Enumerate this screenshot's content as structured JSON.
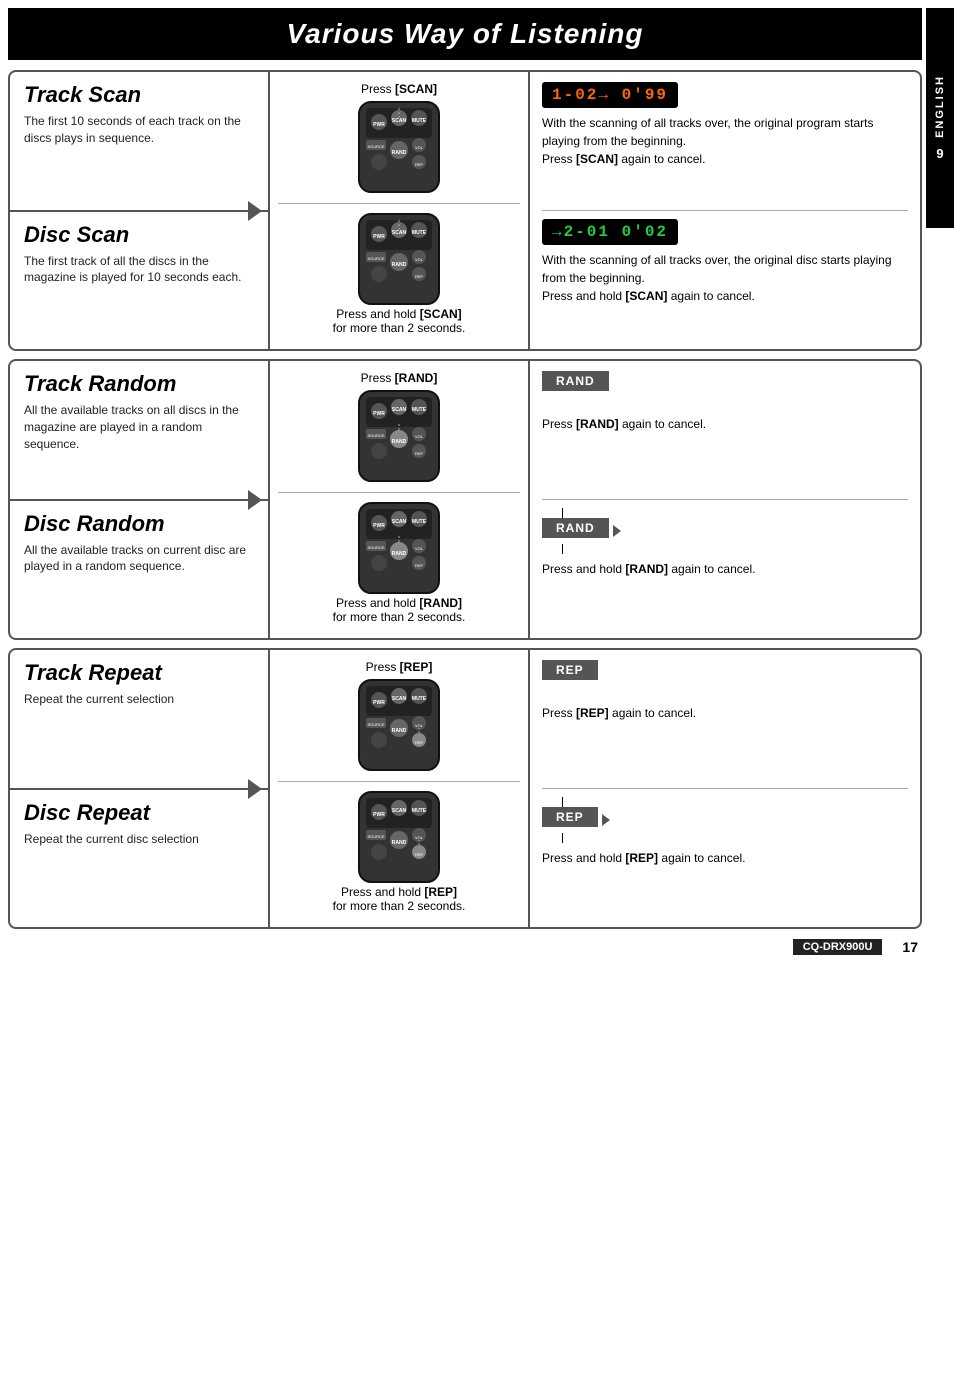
{
  "page": {
    "title": "Various Way of Listening",
    "model": "CQ-DRX900U",
    "page_number": "17",
    "side_tab": {
      "letters": "ENGLISH",
      "number": "9"
    }
  },
  "sections": [
    {
      "id": "scan",
      "features": [
        {
          "id": "track-scan",
          "title": "Track Scan",
          "desc": "The first 10 seconds of each track on the discs plays in sequence."
        },
        {
          "id": "disc-scan",
          "title": "Disc Scan",
          "desc": "The first track of all the discs in the magazine is played for 10 seconds each."
        }
      ],
      "middle": {
        "top_label": "Press [SCAN]",
        "bottom_label": "Press and hold [SCAN] for more than 2 seconds."
      },
      "right": {
        "top": {
          "lcd": "1-02→ 0'99",
          "desc": "With the scanning of all tracks over, the original program starts playing from the beginning.",
          "action": "Press [SCAN] again to cancel."
        },
        "bottom": {
          "lcd": "→2-01  0'02",
          "desc": "With the scanning of all tracks over, the original disc starts playing from the beginning.",
          "action": "Press and hold [SCAN] again to cancel."
        }
      }
    },
    {
      "id": "random",
      "features": [
        {
          "id": "track-random",
          "title": "Track Random",
          "desc": "All the available tracks on all discs in the magazine are played in a random sequence."
        },
        {
          "id": "disc-random",
          "title": "Disc Random",
          "desc": "All the available tracks on current disc are played in a random sequence."
        }
      ],
      "middle": {
        "top_label": "Press [RAND]",
        "bottom_label": "Press and hold [RAND] for more than 2 seconds."
      },
      "right": {
        "top": {
          "badge": "RAND",
          "desc": "",
          "action": "Press [RAND] again to cancel."
        },
        "bottom": {
          "badge": "RAND",
          "arrow": true,
          "desc": "",
          "action": "Press and hold [RAND] again to cancel."
        }
      }
    },
    {
      "id": "repeat",
      "features": [
        {
          "id": "track-repeat",
          "title": "Track Repeat",
          "desc": "Repeat the current selection"
        },
        {
          "id": "disc-repeat",
          "title": "Disc Repeat",
          "desc": "Repeat the current disc selection"
        }
      ],
      "middle": {
        "top_label": "Press [REP]",
        "bottom_label": "Press and hold [REP] for more than 2 seconds."
      },
      "right": {
        "top": {
          "badge": "REP",
          "desc": "",
          "action": "Press [REP] again to cancel."
        },
        "bottom": {
          "badge": "REP",
          "arrow": true,
          "desc": "",
          "action": "Press and hold [REP] again to cancel."
        }
      }
    }
  ]
}
